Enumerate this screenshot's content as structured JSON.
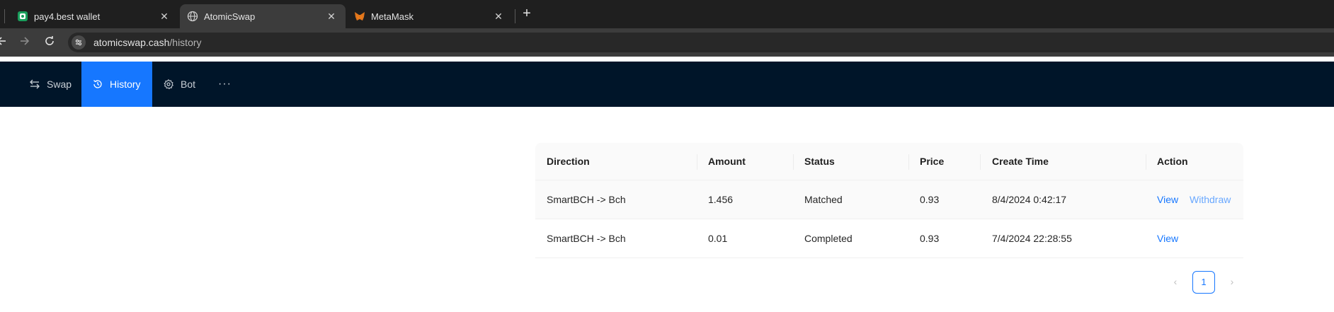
{
  "browser": {
    "tabs": [
      {
        "title": "pay4.best wallet",
        "favicon": "wallet-icon",
        "active": false
      },
      {
        "title": "AtomicSwap",
        "favicon": "globe-icon",
        "active": true
      },
      {
        "title": "MetaMask",
        "favicon": "fox-icon",
        "active": false
      }
    ],
    "close_glyph": "✕",
    "new_tab_glyph": "+",
    "address": {
      "host": "atomicswap.cash",
      "path": "/history"
    }
  },
  "nav": {
    "items": [
      {
        "label": "Swap",
        "icon": "swap-icon",
        "active": false
      },
      {
        "label": "History",
        "icon": "history-icon",
        "active": true
      },
      {
        "label": "Bot",
        "icon": "gear-icon",
        "active": false
      }
    ],
    "more_glyph": "···"
  },
  "table": {
    "columns": [
      "Direction",
      "Amount",
      "Status",
      "Price",
      "Create Time",
      "Action"
    ],
    "rows": [
      {
        "direction": "SmartBCH -> Bch",
        "amount": "1.456",
        "status": "Matched",
        "price": "0.93",
        "create_time": "8/4/2024 0:42:17",
        "actions": [
          "View",
          "Withdraw"
        ]
      },
      {
        "direction": "SmartBCH -> Bch",
        "amount": "0.01",
        "status": "Completed",
        "price": "0.93",
        "create_time": "7/4/2024 22:28:55",
        "actions": [
          "View"
        ]
      }
    ]
  },
  "pagination": {
    "current": "1",
    "prev_glyph": "‹",
    "next_glyph": "›"
  },
  "colors": {
    "nav_bg": "#001529",
    "accent": "#1677ff",
    "chrome_dark": "#1f1f1f",
    "chrome_mid": "#3c3c3c"
  }
}
